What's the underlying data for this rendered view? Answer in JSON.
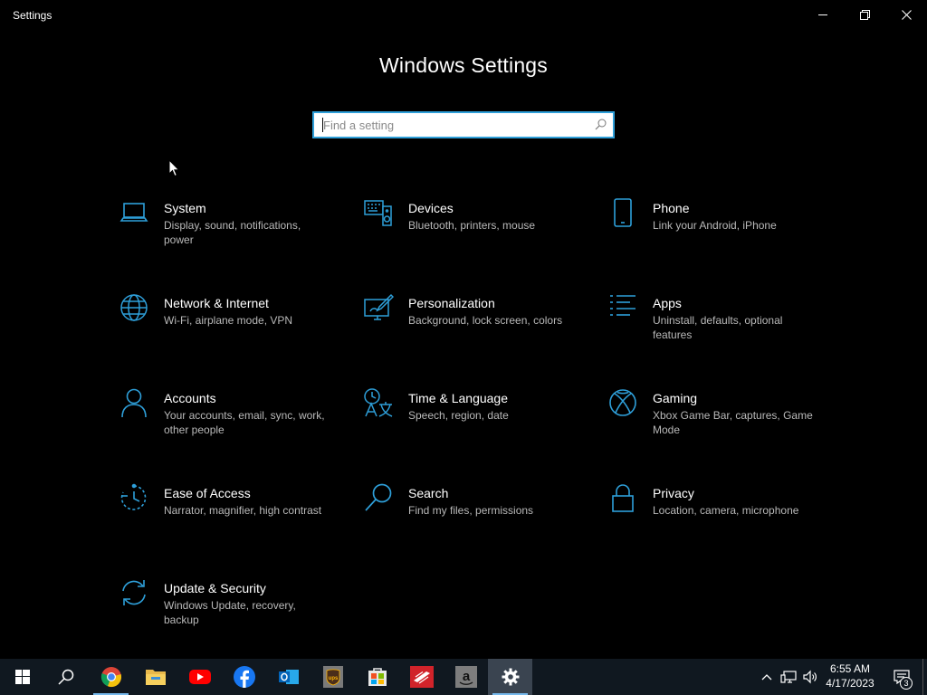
{
  "window": {
    "title": "Settings",
    "controls": [
      "minimize",
      "restore",
      "close"
    ]
  },
  "main": {
    "heading": "Windows Settings",
    "search": {
      "placeholder": "Find a setting",
      "value": ""
    }
  },
  "categories": [
    {
      "name": "System",
      "description": "Display, sound, notifications, power",
      "icon": "laptop-icon"
    },
    {
      "name": "Devices",
      "description": "Bluetooth, printers, mouse",
      "icon": "devices-icon"
    },
    {
      "name": "Phone",
      "description": "Link your Android, iPhone",
      "icon": "phone-icon"
    },
    {
      "name": "Network & Internet",
      "description": "Wi-Fi, airplane mode, VPN",
      "icon": "globe-icon"
    },
    {
      "name": "Personalization",
      "description": "Background, lock screen, colors",
      "icon": "paint-icon"
    },
    {
      "name": "Apps",
      "description": "Uninstall, defaults, optional features",
      "icon": "apps-list-icon"
    },
    {
      "name": "Accounts",
      "description": "Your accounts, email, sync, work, other people",
      "icon": "person-icon"
    },
    {
      "name": "Time & Language",
      "description": "Speech, region, date",
      "icon": "time-language-icon"
    },
    {
      "name": "Gaming",
      "description": "Xbox Game Bar, captures, Game Mode",
      "icon": "xbox-icon"
    },
    {
      "name": "Ease of Access",
      "description": "Narrator, magnifier, high contrast",
      "icon": "ease-of-access-icon"
    },
    {
      "name": "Search",
      "description": "Find my files, permissions",
      "icon": "search-icon"
    },
    {
      "name": "Privacy",
      "description": "Location, camera, microphone",
      "icon": "lock-icon"
    },
    {
      "name": "Update & Security",
      "description": "Windows Update, recovery, backup",
      "icon": "sync-icon"
    }
  ],
  "taskbar": {
    "apps": [
      "start-icon",
      "search-icon",
      "chrome-icon",
      "file-explorer-icon",
      "youtube-icon",
      "facebook-icon",
      "outlook-icon",
      "ups-icon",
      "store-icon",
      "bank-icon",
      "amazon-icon",
      "settings-gear-icon"
    ],
    "clock": {
      "time": "6:55 AM",
      "date": "4/17/2023"
    },
    "notification_count": "3"
  },
  "colors": {
    "accent": "#2e9fd9",
    "background": "#000000",
    "taskbar": "#101820",
    "description_text": "#b8b8b8"
  }
}
